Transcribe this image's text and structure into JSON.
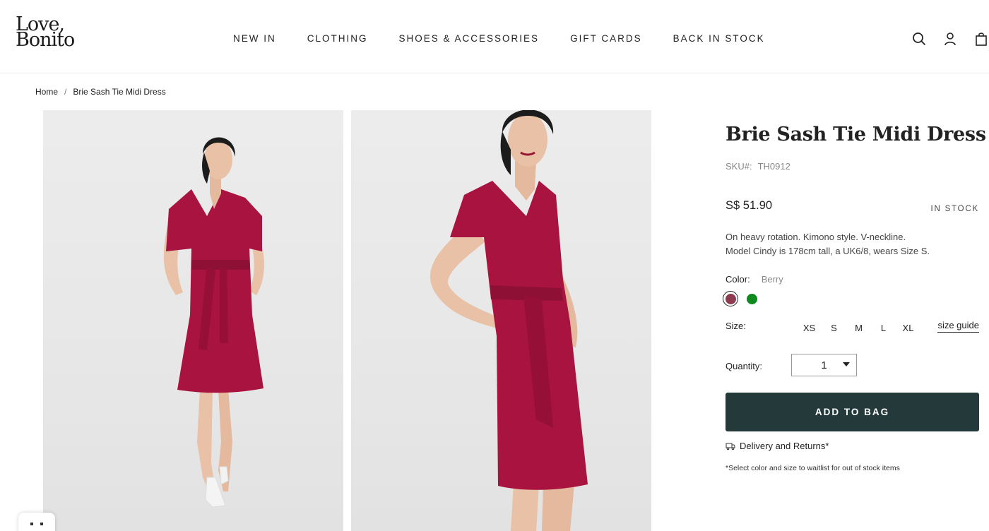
{
  "brand": {
    "logo_line1": "Love,",
    "logo_line2": "Bonito"
  },
  "nav": {
    "items": [
      "NEW IN",
      "CLOTHING",
      "SHOES & ACCESSORIES",
      "GIFT CARDS",
      "BACK IN STOCK"
    ]
  },
  "header_icons": [
    "search-icon",
    "user-icon",
    "bag-icon"
  ],
  "breadcrumb": {
    "home": "Home",
    "separator": "/",
    "current": "Brie Sash Tie Midi Dress"
  },
  "product": {
    "title": "Brie Sash Tie Midi Dress",
    "sku_label": "SKU#:",
    "sku": "TH0912",
    "price": "S$ 51.90",
    "stock_status": "IN STOCK",
    "description_line1": "On heavy rotation. Kimono style. V-neckline.",
    "description_line2": "Model Cindy is 178cm tall, a UK6/8, wears Size S.",
    "color_label": "Color:",
    "color_value": "Berry",
    "colors": [
      {
        "name": "Berry",
        "hex": "#8e3a4f",
        "selected": true
      },
      {
        "name": "Green",
        "hex": "#0f8a1f",
        "selected": false
      }
    ],
    "size_label": "Size:",
    "sizes": [
      "XS",
      "S",
      "M",
      "L",
      "XL"
    ],
    "size_guide": "size guide",
    "quantity_label": "Quantity:",
    "quantity_value": "1",
    "add_to_bag": "ADD TO BAG",
    "delivery_link": "Delivery and Returns*",
    "waitlist_note": "*Select color and size to waitlist for out of stock items"
  },
  "colors": {
    "dress": "#a8133f",
    "button_bg": "#24393a",
    "image_bg": "#ebebeb"
  }
}
